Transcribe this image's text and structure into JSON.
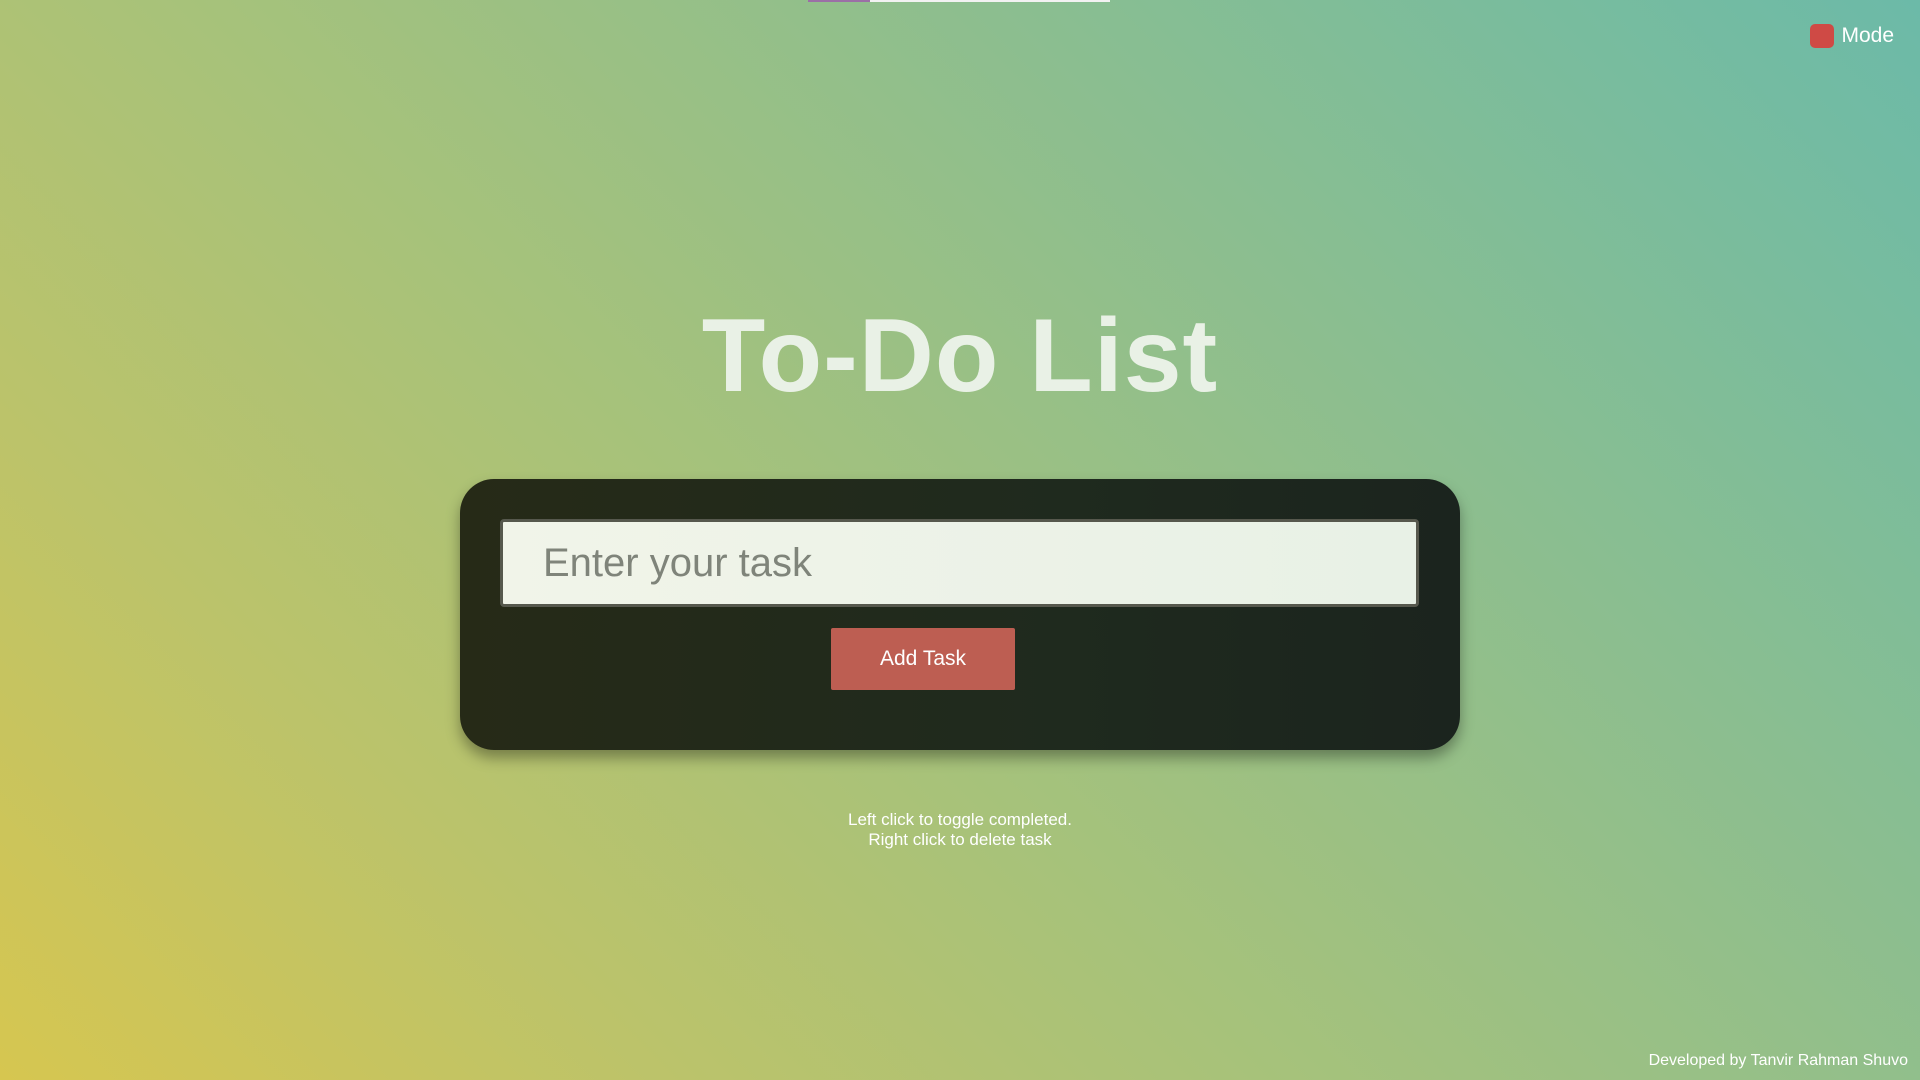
{
  "app": {
    "title": "To-Do List"
  },
  "mode_toggle": {
    "label": "Mode",
    "icon": "square-swatch-icon",
    "color": "#cf4a45"
  },
  "task_form": {
    "input_placeholder": "Enter your task",
    "input_value": "",
    "add_button_label": "Add Task",
    "button_color": "#bd5e52"
  },
  "hints": {
    "line1": "Left click to toggle completed.",
    "line2": "Right click to delete task"
  },
  "footer": {
    "credit": "Developed by Tanvir Rahman Shuvo"
  }
}
